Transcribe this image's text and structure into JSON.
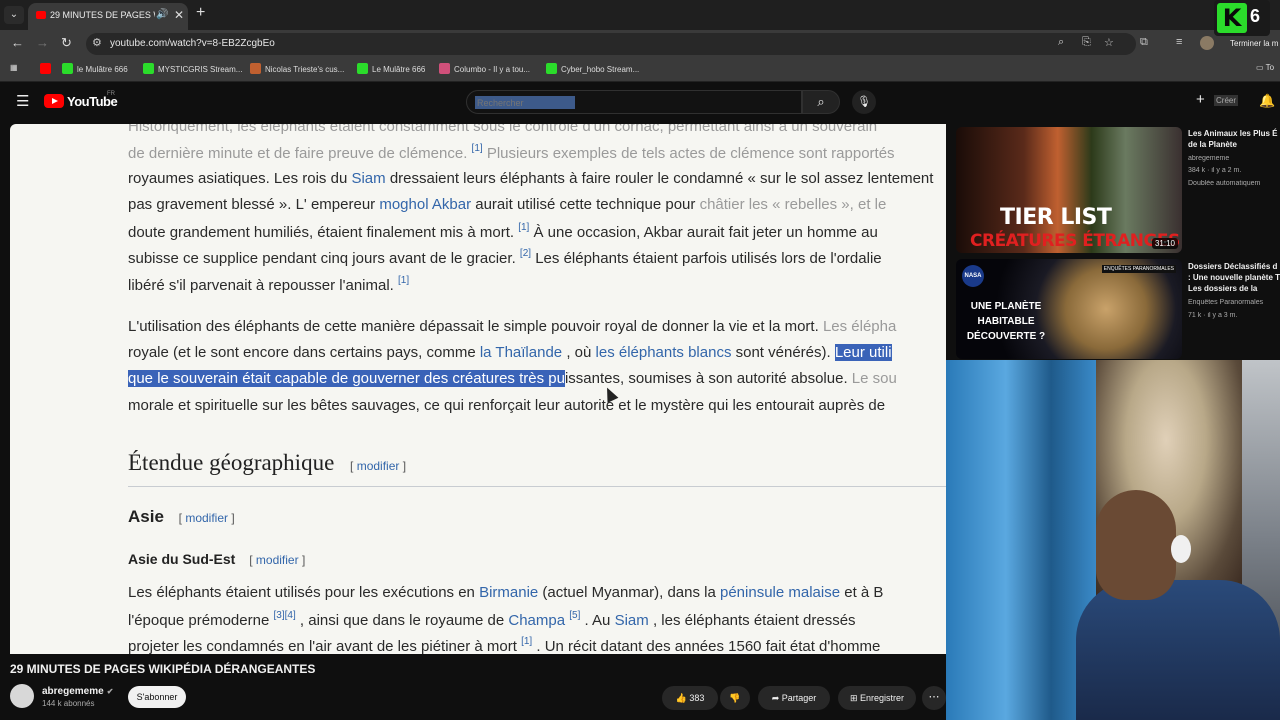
{
  "browser": {
    "tab_title": "29 MINUTES DE PAGES WIK",
    "url": "youtube.com/watch?v=8-EB2ZcgbEo",
    "finish_label": "Terminer la m",
    "bookmarks": [
      {
        "label": "le Mulâtre 666",
        "color": "#2bdc2b"
      },
      {
        "label": "MYSTICGRIS Stream...",
        "color": "#2bdc2b"
      },
      {
        "label": "Nicolas Trieste's cus...",
        "color": "#c06030"
      },
      {
        "label": "Le Mulâtre 666",
        "color": "#2bdc2b"
      },
      {
        "label": "Columbo - Il y a tou...",
        "color": "#d0507a"
      },
      {
        "label": "Cyber_hobo Stream...",
        "color": "#2bdc2b"
      }
    ],
    "bookmarks_folder": "To"
  },
  "youtube": {
    "wordmark": "YouTube",
    "region": "FR",
    "search_placeholder": "Rechercher",
    "create_label": "Créer"
  },
  "wiki": {
    "line0": "Historiquement, les éléphants étaient constamment sous le contrôle d'un cornac, permettant ainsi à un souverain",
    "line1a": "de dernière minute et de faire preuve de clémence.",
    "line1_sup": "[1]",
    "line1b": "Plusieurs exemples de tels actes de clémence sont rapportés",
    "line2a": "royaumes asiatiques. Les rois du",
    "line2_link": "Siam",
    "line2b": "dressaient leurs éléphants à faire rouler le condamné « sur le sol assez lentement",
    "line3a": "pas gravement blessé ». L' empereur",
    "line3_link": "moghol Akbar",
    "line3b": "aurait utilisé cette technique pour",
    "line3c": "châtier les « rebelles », et le",
    "line4a": "doute grandement humiliés, étaient finalement mis à mort.",
    "line4_sup": "[1]",
    "line4b": "À une occasion, Akbar aurait fait jeter un homme au",
    "line5a": "subisse ce supplice pendant cinq jours avant de le gracier.",
    "line5_sup": "[2]",
    "line5b": "Les éléphants étaient parfois utilisés lors de l'ordalie",
    "line6a": "libéré s'il parvenait à repousser l'animal.",
    "line6_sup": "[1]",
    "p2_line1a": "L'utilisation des éléphants de cette manière dépassait le simple pouvoir royal de donner la vie et la mort.",
    "p2_line1b": "Les élépha",
    "p2_line2a": "royale (et le sont encore dans certains pays, comme",
    "p2_line2_link1": "la Thaïlande",
    "p2_line2b": ", où",
    "p2_line2_link2": "les éléphants blancs",
    "p2_line2c": "sont vénérés).",
    "p2_line2_hl": "Leur utili",
    "p2_line3_hl": "que le souverain était capable de gouverner des créatures très pu",
    "p2_line3b": "issantes, soumises à son autorité absolue.",
    "p2_line3c": "Le sou",
    "p2_line4": "morale et spirituelle sur les bêtes sauvages, ce qui renforçait leur autorité et le mystère qui les entourait auprès de",
    "h2": "Étendue géographique",
    "edit": "modifier",
    "h3": "Asie",
    "h4": "Asie du Sud-Est",
    "p3_line1a": "Les éléphants étaient utilisés pour les exécutions en",
    "p3_line1_link": "Birmanie",
    "p3_line1b": "(actuel Myanmar), dans la",
    "p3_line1_link2": "péninsule malaise",
    "p3_line1c": "et à B",
    "p3_line2a": "l'époque prémoderne",
    "p3_line2_sup": "[3][4]",
    "p3_line2b": ", ainsi que dans le royaume de",
    "p3_line2_link": "Champa",
    "p3_line2_sup2": "[5]",
    "p3_line2c": ". Au",
    "p3_line2_link2": "Siam",
    "p3_line2d": ", les éléphants étaient dressés",
    "p3_line3a": "projeter les condamnés en l'air avant de les piétiner à mort",
    "p3_line3_sup": "[1]",
    "p3_line3b": ". Un récit datant des années 1560 fait état d'homme"
  },
  "video": {
    "title": "29 MINUTES DE PAGES WIKIPÉDIA DÉRANGEANTES",
    "channel": "abregememe",
    "subscribers": "144 k abonnés",
    "subscribe_label": "S'abonner",
    "likes": "383",
    "share_label": "Partager",
    "save_label": "Enregistrer"
  },
  "recommendations": [
    {
      "title": "Les Animaux les Plus É de la Planète",
      "channel": "abregememe",
      "meta": "384 k · il y a 2 m.",
      "badge": "Doublée automatiquem",
      "thumb_line1": "TIER LIST",
      "thumb_line2": "CRÉATURES ÉTRANGES",
      "duration": "31:10"
    },
    {
      "title": "Dossiers Déclassifiés d : Une nouvelle planète T Les dossiers de la NASA",
      "channel": "Enquêtes Paranormales",
      "meta": "71 k · il y a 3 m.",
      "thumb_text": "UNE PLANÈTE HABITABLE DÉCOUVERTE ?",
      "thumb_badge": "ENQUÊTES PARANORMALES",
      "thumb_logo": "NASA"
    }
  ],
  "overlay": {
    "k": "K",
    "six": "6"
  }
}
